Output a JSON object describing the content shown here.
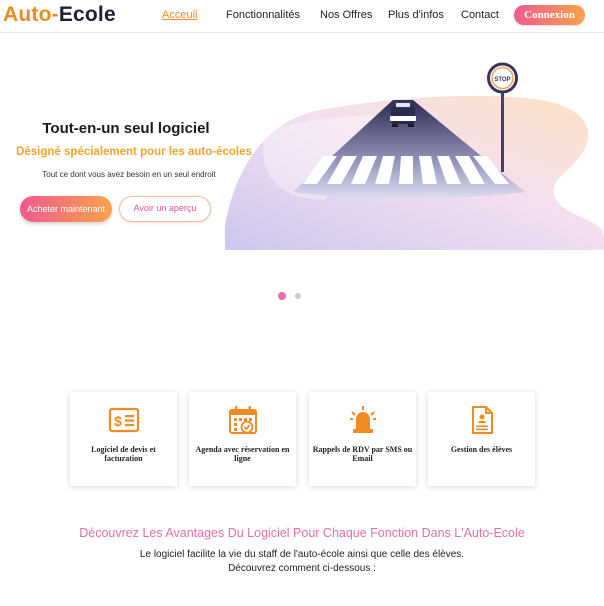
{
  "header": {
    "logo_part1": "Auto-",
    "logo_part2": "Ecole",
    "nav": [
      "Acceuil",
      "Fonctionnalités",
      "Nos Offres",
      "Plus d'infos",
      "Contact"
    ],
    "connect_label": "Connexion"
  },
  "hero": {
    "title": "Tout-en-un seul logiciel",
    "subtitle": "Désigné spécialement pour les auto-écoles",
    "description": "Tout ce dont vous avez besoin en un seul endroit",
    "buy_label": "Acheter maintenant",
    "preview_label": "Avoir un aperçu",
    "sign_text": "STOP"
  },
  "features": [
    {
      "label": "Logiciel de devis et facturation",
      "icon": "invoice-icon"
    },
    {
      "label": "Agenda avec réservation en ligne",
      "icon": "calendar-icon"
    },
    {
      "label": "Rappels de RDV par SMS ou Email",
      "icon": "alarm-icon"
    },
    {
      "label": "Gestion des élèves",
      "icon": "document-icon"
    }
  ],
  "advantages": {
    "title": "Découvrez Les Avantages Du Logiciel Pour Chaque Fonction Dans L'Auto-Ecole",
    "line1": "Le logiciel facilite la vie du staff de l'auto-école ainsi que celle des élèves.",
    "line2": "Découvrez comment ci-dessous :"
  },
  "colors": {
    "brand_orange": "#f18a1f",
    "brand_navy": "#1d1f3c",
    "accent_pink": "#e070a8",
    "feature_icon": "#f08a24"
  }
}
